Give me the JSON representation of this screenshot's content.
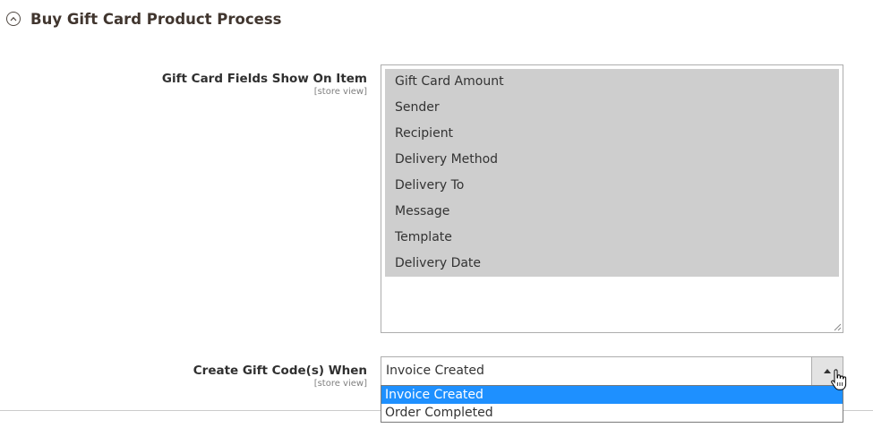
{
  "section": {
    "title": "Buy Gift Card Product Process",
    "icon": "chevron-up-circle-icon"
  },
  "fields": {
    "gift_card_fields": {
      "label": "Gift Card Fields Show On Item",
      "scope": "[store view]",
      "options": [
        {
          "label": "Gift Card Amount",
          "selected": true
        },
        {
          "label": "Sender",
          "selected": true
        },
        {
          "label": "Recipient",
          "selected": true
        },
        {
          "label": "Delivery Method",
          "selected": true
        },
        {
          "label": "Delivery To",
          "selected": true
        },
        {
          "label": "Message",
          "selected": true
        },
        {
          "label": "Template",
          "selected": true
        },
        {
          "label": "Delivery Date",
          "selected": true
        }
      ]
    },
    "create_gift_code": {
      "label": "Create Gift Code(s) When",
      "scope": "[store view]",
      "value": "Invoice Created",
      "options": [
        {
          "label": "Invoice Created",
          "highlighted": true
        },
        {
          "label": "Order Completed",
          "highlighted": false
        }
      ]
    }
  },
  "colors": {
    "selected_option_bg": "#cecece",
    "dropdown_highlight": "#1e90ff"
  }
}
